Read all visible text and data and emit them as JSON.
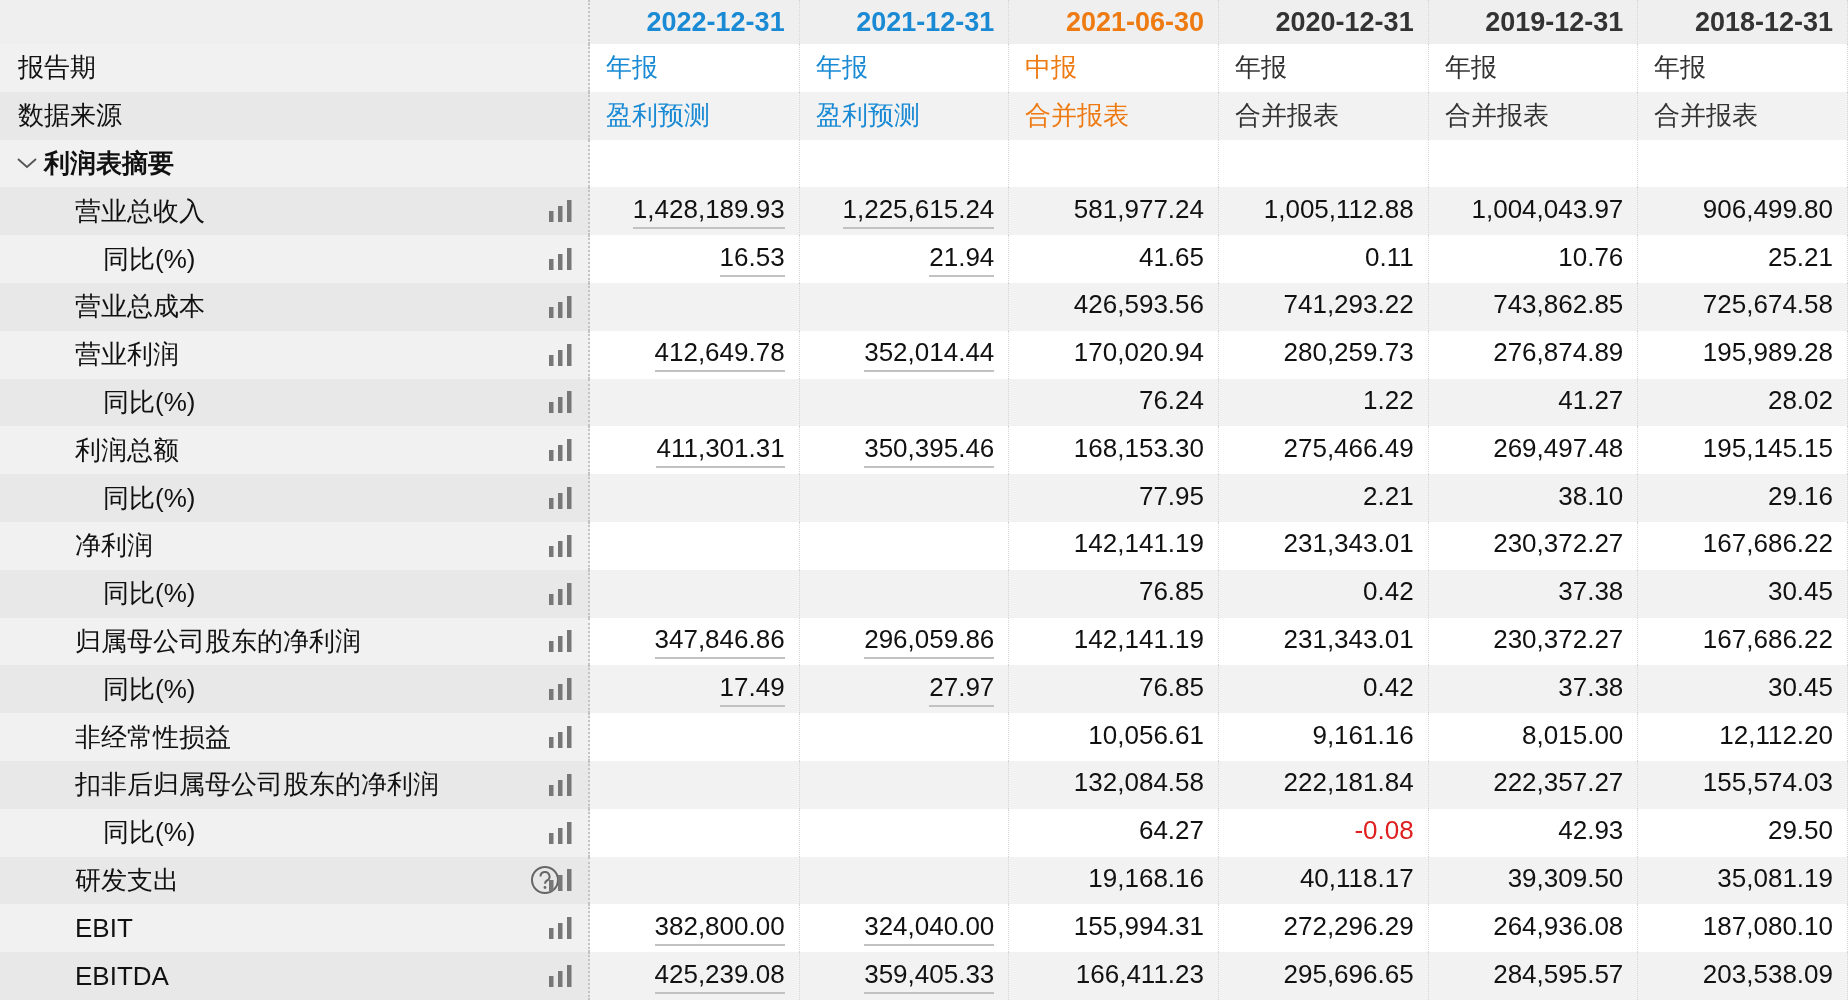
{
  "period_label": "报告期",
  "source_label": "数据来源",
  "columns": [
    {
      "date": "2022-12-31",
      "period": "年报",
      "source": "盈利预测",
      "color": "#1a8ad4",
      "linked": true
    },
    {
      "date": "2021-12-31",
      "period": "年报",
      "source": "盈利预测",
      "color": "#1a8ad4",
      "linked": true
    },
    {
      "date": "2021-06-30",
      "period": "中报",
      "source": "合并报表",
      "color": "#ee7a12",
      "linked": false
    },
    {
      "date": "2020-12-31",
      "period": "年报",
      "source": "合并报表",
      "color": "#333333",
      "linked": false
    },
    {
      "date": "2019-12-31",
      "period": "年报",
      "source": "合并报表",
      "color": "#333333",
      "linked": false
    },
    {
      "date": "2018-12-31",
      "period": "年报",
      "source": "合并报表",
      "color": "#333333",
      "linked": false
    }
  ],
  "sections": [
    {
      "label": "利润表摘要",
      "expanded": true,
      "rows": [
        {
          "label": "营业总收入",
          "values": [
            "1,428,189.93",
            "1,225,615.24",
            "581,977.24",
            "1,005,112.88",
            "1,004,043.97",
            "906,499.80"
          ],
          "children": [
            {
              "label": "同比(%)",
              "values": [
                "16.53",
                "21.94",
                "41.65",
                "0.11",
                "10.76",
                "25.21"
              ]
            }
          ]
        },
        {
          "label": "营业总成本",
          "values": [
            "426,593.56",
            "741,293.22",
            "743,862.85",
            "725,674.58"
          ]
        },
        {
          "label": "营业利润",
          "values": [
            "412,649.78",
            "352,014.44",
            "170,020.94",
            "280,259.73",
            "276,874.89",
            "195,989.28"
          ],
          "children": [
            {
              "label": "同比(%)",
              "values": [
                "76.24",
                "1.22",
                "41.27",
                "28.02"
              ]
            }
          ]
        },
        {
          "label": "利润总额",
          "values": [
            "411,301.31",
            "350,395.46",
            "168,153.30",
            "275,466.49",
            "269,497.48",
            "195,145.15"
          ],
          "children": [
            {
              "label": "同比(%)",
              "values": [
                "77.95",
                "2.21",
                "38.10",
                "29.16"
              ]
            }
          ]
        },
        {
          "label": "净利润",
          "values": [
            "142,141.19",
            "231,343.01",
            "230,372.27",
            "167,686.22"
          ],
          "children": [
            {
              "label": "同比(%)",
              "values": [
                "76.85",
                "0.42",
                "37.38",
                "30.45"
              ]
            }
          ]
        },
        {
          "label": "归属母公司股东的净利润",
          "values": [
            "347,846.86",
            "296,059.86",
            "142,141.19",
            "231,343.01",
            "230,372.27",
            "167,686.22"
          ],
          "children": [
            {
              "label": "同比(%)",
              "values": [
                "17.49",
                "27.97",
                "76.85",
                "0.42",
                "37.38",
                "30.45"
              ]
            }
          ]
        },
        {
          "label": "非经常性损益",
          "values": [
            "10,056.61",
            "9,161.16",
            "8,015.00",
            "12,112.20"
          ]
        },
        {
          "label": "扣非后归属母公司股东的净利润",
          "values": [
            "132,084.58",
            "222,181.84",
            "222,357.27",
            "155,574.03"
          ],
          "children": [
            {
              "label": "同比(%)",
              "values": [
                "64.27",
                {
                  "text": "-0.08",
                  "negative": true
                },
                "42.93",
                "29.50"
              ]
            }
          ]
        },
        {
          "label": "研发支出",
          "help": true,
          "values": [
            "19,168.16",
            "40,118.17",
            "39,309.50",
            "35,081.19"
          ]
        },
        {
          "label": "EBIT",
          "values": [
            "382,800.00",
            "324,040.00",
            "155,994.31",
            "272,296.29",
            "264,936.08",
            "187,080.10"
          ]
        },
        {
          "label": "EBITDA",
          "values": [
            "425,239.08",
            "359,405.33",
            "166,411.23",
            "295,696.65",
            "284,595.57",
            "203,538.09"
          ]
        }
      ]
    }
  ]
}
